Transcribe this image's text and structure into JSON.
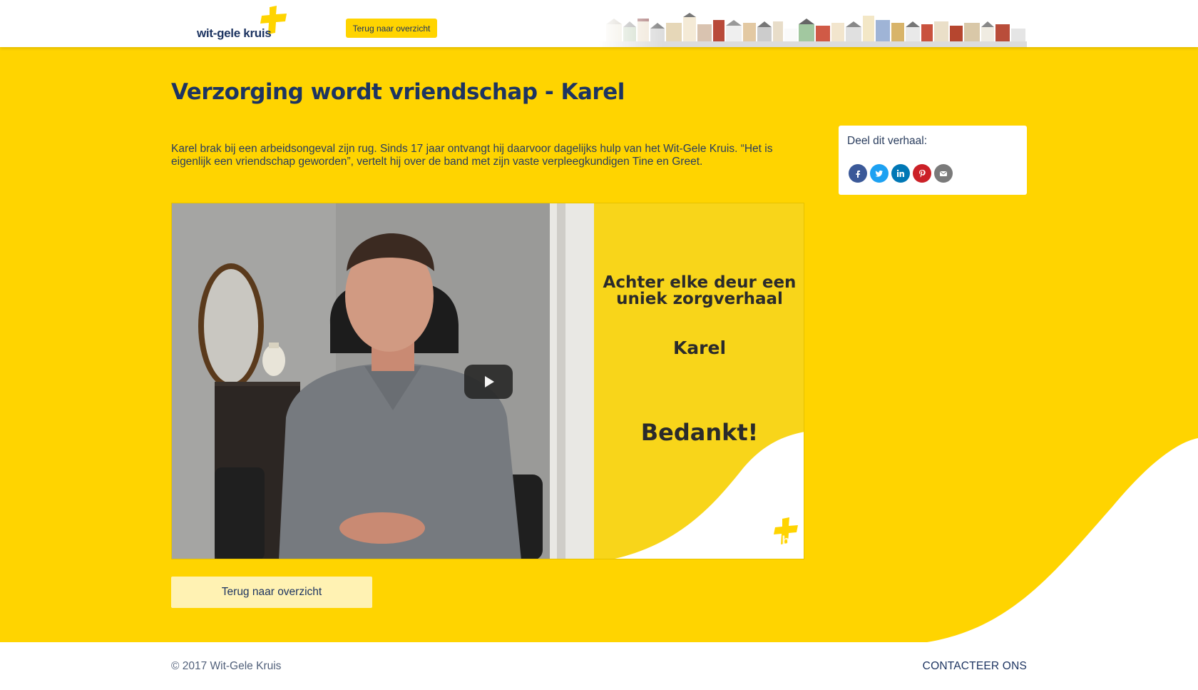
{
  "header": {
    "logo_text": "wit-gele kruis",
    "back_button_label": "Terug naar overzicht"
  },
  "page": {
    "title": "Verzorging wordt vriendschap - Karel",
    "intro": "Karel brak bij een arbeidsongeval zijn rug. Sinds 17 jaar ontvangt hij daarvoor dagelijks hulp van het Wit-Gele Kruis. “Het is eigenlijk een vriendschap geworden”, vertelt hij over de band met zijn vaste verpleegkundigen Tine en Greet."
  },
  "share": {
    "label": "Deel dit verhaal:",
    "icons": [
      "facebook-icon",
      "twitter-icon",
      "linkedin-icon",
      "pinterest-icon",
      "email-icon"
    ]
  },
  "video": {
    "headline_line1": "Achter elke deur een",
    "headline_line2": "uniek zorgverhaal",
    "name": "Karel",
    "thanks": "Bedankt!",
    "platform": "YouTube"
  },
  "actions": {
    "back_label": "Terug naar overzicht"
  },
  "footer": {
    "copyright": "© 2017 Wit-Gele Kruis",
    "contact_label": "CONTACTEER ONS"
  },
  "colors": {
    "brand_yellow": "#ffd400",
    "brand_navy": "#1d3461",
    "white": "#ffffff"
  }
}
